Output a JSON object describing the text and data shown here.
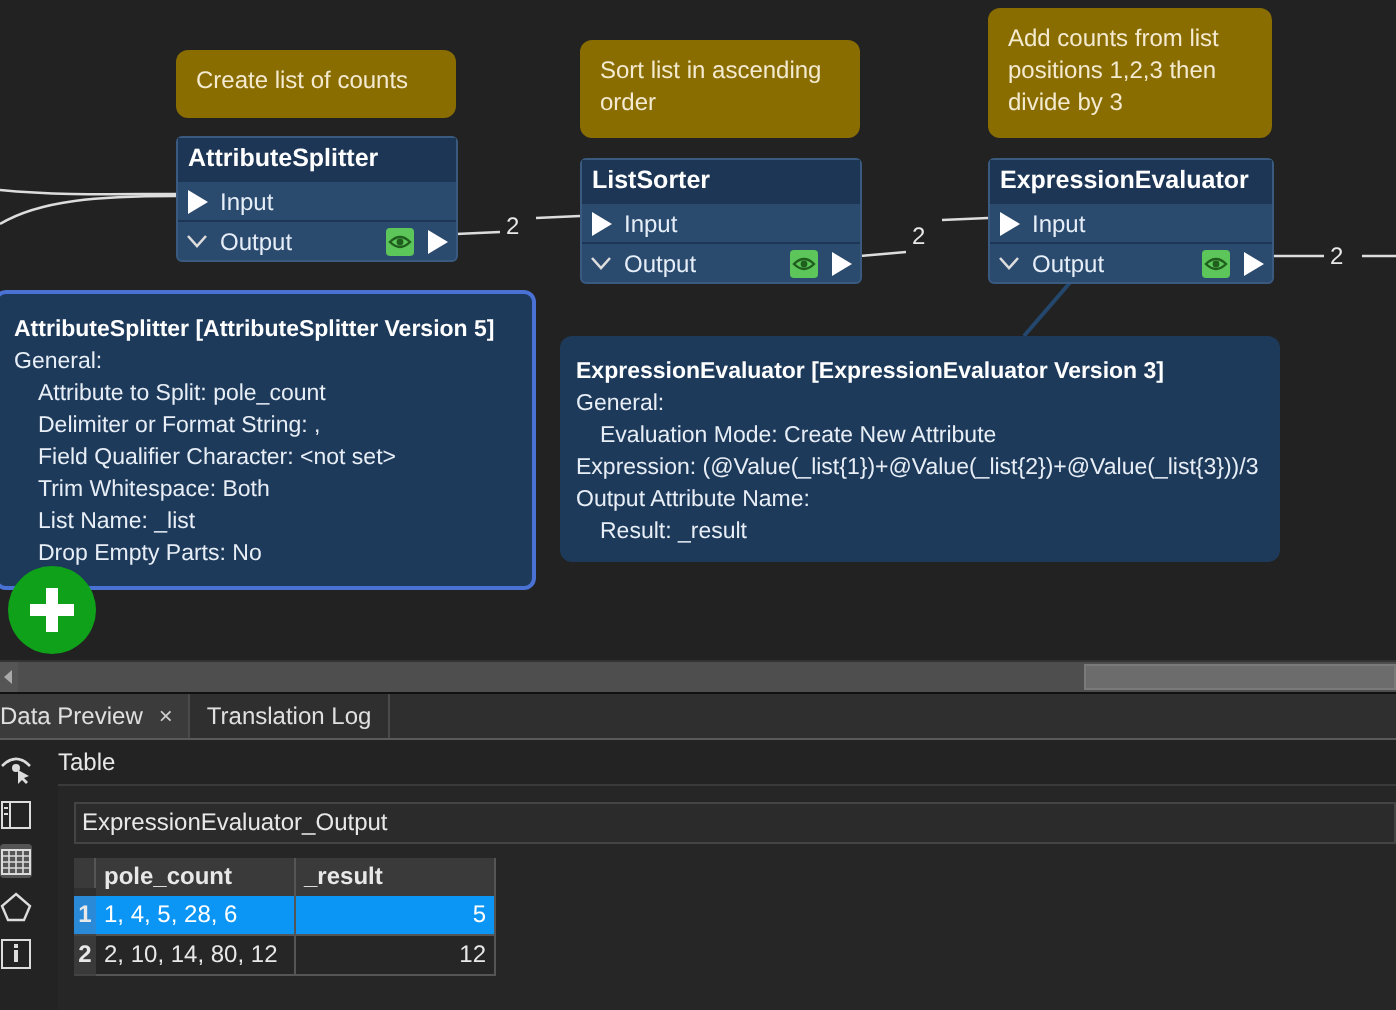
{
  "canvas": {
    "annotations": [
      {
        "text": "Create list of counts"
      },
      {
        "text": "Sort list in ascending order"
      },
      {
        "text": "Add counts from list positions 1,2,3 then divide by 3"
      }
    ],
    "transformers": [
      {
        "name": "AttributeSplitter",
        "ports": [
          {
            "kind": "input",
            "label": "Input"
          },
          {
            "kind": "output",
            "label": "Output",
            "inspect": true
          }
        ]
      },
      {
        "name": "ListSorter",
        "ports": [
          {
            "kind": "input",
            "label": "Input"
          },
          {
            "kind": "output",
            "label": "Output",
            "inspect": true
          }
        ]
      },
      {
        "name": "ExpressionEvaluator",
        "ports": [
          {
            "kind": "input",
            "label": "Input"
          },
          {
            "kind": "output",
            "label": "Output",
            "inspect": true
          }
        ]
      }
    ],
    "connection_counts": [
      "2",
      "2",
      "2"
    ],
    "tooltips": [
      {
        "title": "AttributeSplitter [AttributeSplitter Version 5]",
        "bordered": true,
        "lines": [
          {
            "text": "General:",
            "indented": false
          },
          {
            "text": "Attribute to Split: pole_count",
            "indented": true
          },
          {
            "text": "Delimiter or Format String: ,",
            "indented": true
          },
          {
            "text": "Field Qualifier Character: <not set>",
            "indented": true
          },
          {
            "text": "Trim Whitespace: Both",
            "indented": true
          },
          {
            "text": "List Name: _list",
            "indented": true
          },
          {
            "text": "Drop Empty Parts: No",
            "indented": true
          }
        ]
      },
      {
        "title": "ExpressionEvaluator [ExpressionEvaluator Version 3]",
        "bordered": false,
        "lines": [
          {
            "text": "General:",
            "indented": false
          },
          {
            "text": "Evaluation Mode: Create New Attribute",
            "indented": true
          },
          {
            "text": "Expression: (@Value(_list{1})+@Value(_list{2})+@Value(_list{3}))/3",
            "indented": false
          },
          {
            "text": "Output Attribute Name:",
            "indented": false
          },
          {
            "text": "Result: _result",
            "indented": true
          }
        ]
      }
    ]
  },
  "bottom_panel": {
    "tabs": [
      {
        "label": "Data Preview",
        "close": "×",
        "selected": true
      },
      {
        "label": "Translation Log",
        "selected": false
      }
    ],
    "toolbar": [
      {
        "kind": "eye",
        "selected": false
      },
      {
        "kind": "form",
        "selected": false
      },
      {
        "kind": "grid",
        "selected": true
      },
      {
        "kind": "pointer",
        "selected": false
      },
      {
        "kind": "info",
        "selected": false
      }
    ],
    "section_title": "Table",
    "table_selector": "ExpressionEvaluator_Output",
    "table": {
      "columns": [
        "pole_count",
        "_result"
      ],
      "rows": [
        {
          "number": "1",
          "cells": [
            "1, 4, 5, 28, 6",
            "5"
          ],
          "selected": true
        },
        {
          "number": "2",
          "cells": [
            "2, 10, 14, 80, 12",
            "12"
          ],
          "selected": false
        }
      ]
    }
  }
}
